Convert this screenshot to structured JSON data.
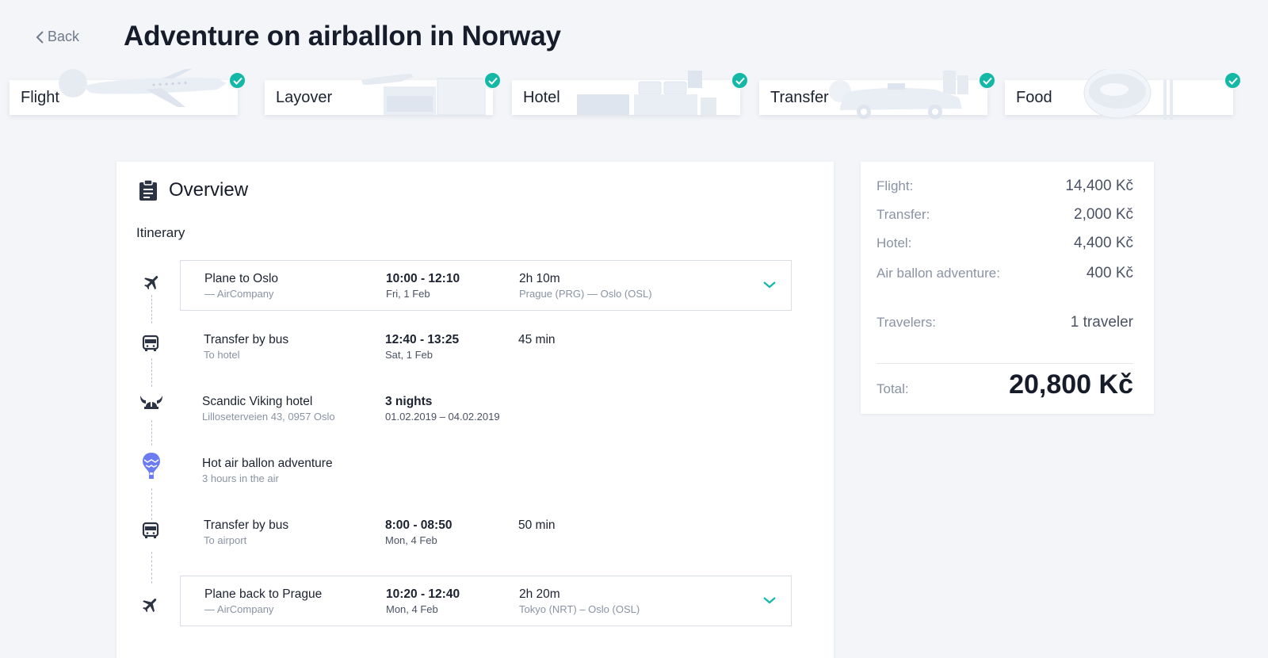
{
  "header": {
    "back_label": "Back",
    "title": "Adventure on airballon in Norway"
  },
  "steps": [
    {
      "label": "Flight",
      "icon": "plane-illustration",
      "done": true
    },
    {
      "label": "Layover",
      "icon": "lounge-illustration",
      "done": true
    },
    {
      "label": "Hotel",
      "icon": "hotel-room-illustration",
      "done": true
    },
    {
      "label": "Transfer",
      "icon": "car-illustration",
      "done": true
    },
    {
      "label": "Food",
      "icon": "plate-illustration",
      "done": true
    }
  ],
  "overview": {
    "title": "Overview",
    "itinerary_label": "Itinerary",
    "items": [
      {
        "icon": "plane-icon",
        "name": "Plane to Oslo",
        "sub": "—  AirCompany",
        "time": "10:00 - 12:10",
        "date": "Fri, 1 Feb",
        "duration": "2h 10m",
        "route": "Prague (PRG) — Oslo (OSL)",
        "expandable": true
      },
      {
        "icon": "bus-icon",
        "name": "Transfer by bus",
        "sub": "To hotel",
        "time": "12:40 - 13:25",
        "date": "Sat, 1 Feb",
        "duration": "45 min",
        "route": "",
        "expandable": false
      },
      {
        "icon": "viking-helmet-icon",
        "name": "Scandic Viking hotel",
        "sub": "Lilloseterveien 43, 0957 Oslo",
        "time": "3 nights",
        "date": "01.02.2019 – 04.02.2019",
        "duration": "",
        "route": "",
        "expandable": false
      },
      {
        "icon": "hot-air-balloon-icon",
        "name": "Hot air ballon adventure",
        "sub": "3 hours in the air",
        "time": "",
        "date": "",
        "duration": "",
        "route": "",
        "expandable": false
      },
      {
        "icon": "bus-icon",
        "name": "Transfer by bus",
        "sub": "To airport",
        "time": "8:00 - 08:50",
        "date": "Mon, 4 Feb",
        "duration": "50 min",
        "route": "",
        "expandable": false
      },
      {
        "icon": "plane-icon",
        "name": "Plane back to Prague",
        "sub": "—  AirCompany",
        "time": "10:20 - 12:40",
        "date": "Mon, 4 Feb",
        "duration": "2h 20m",
        "route": "Tokyo (NRT) – Oslo (OSL)",
        "expandable": true
      }
    ]
  },
  "summary": {
    "lines": [
      {
        "label": "Flight:",
        "value": "14,400 Kč"
      },
      {
        "label": "Transfer:",
        "value": "2,000 Kč"
      },
      {
        "label": "Hotel:",
        "value": "4,400 Kč"
      },
      {
        "label": "Air ballon adventure:",
        "value": "400 Kč"
      }
    ],
    "travelers_label": "Travelers:",
    "travelers_value": "1 traveler",
    "total_label": "Total:",
    "total_value": "20,800 Kč"
  },
  "colors": {
    "accent": "#14b8a6",
    "balloon": "#6b7cf0",
    "background": "#f3f5f9"
  }
}
